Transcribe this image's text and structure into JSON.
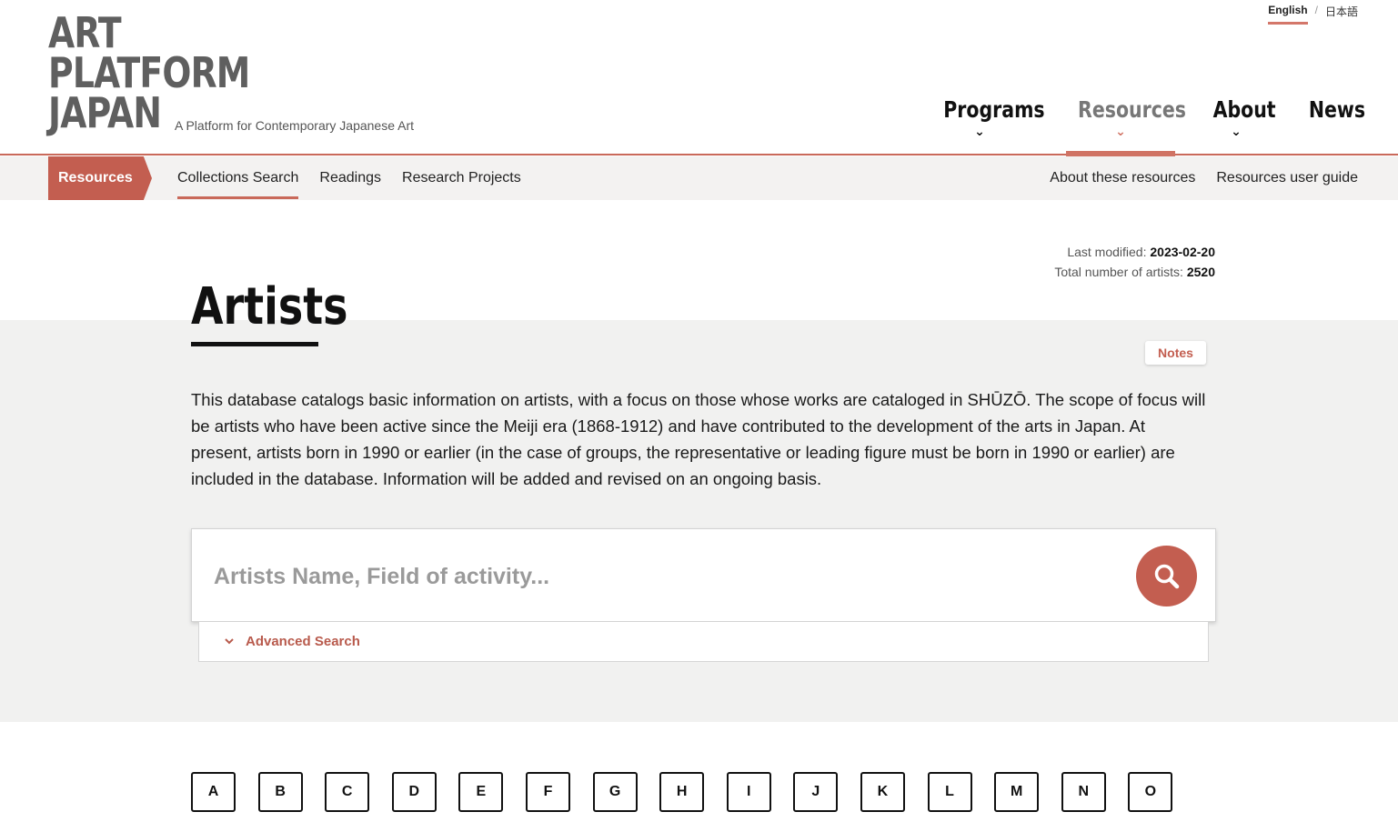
{
  "brand": {
    "logo_lines": [
      "ART",
      "PLATFORM",
      "JAPAN"
    ],
    "tagline": "A Platform for Contemporary Japanese Art"
  },
  "language": {
    "english": "English",
    "separator": "/",
    "japanese": "日本語"
  },
  "main_nav": {
    "programs": "Programs",
    "resources": "Resources",
    "about": "About",
    "news": "News",
    "active": "Resources"
  },
  "subnav": {
    "section_label": "Resources",
    "links": [
      "Collections Search",
      "Readings",
      "Research Projects"
    ],
    "right_links": [
      "About these resources",
      "Resources user guide"
    ]
  },
  "page": {
    "last_modified_label": "Last modified: ",
    "last_modified_value": "2023-02-20",
    "total_label": "Total number of artists: ",
    "total_value": "2520",
    "title": "Artists",
    "notes_label": "Notes",
    "description": "This database catalogs basic information on artists, with a focus on those whose works are cataloged in SHŪZŌ. The scope of focus will be artists who have been active since the Meiji era (1868-1912) and have contributed to the development of the arts in Japan. At present, artists born in 1990 or earlier (in the case of groups, the representative or leading figure must be born in 1990 or earlier) are included in the database. Information will be added and revised on an ongoing basis."
  },
  "search": {
    "placeholder": "Artists Name, Field of activity...",
    "value": "",
    "advanced_label": "Advanced Search"
  },
  "alphabet": [
    "A",
    "B",
    "C",
    "D",
    "E",
    "F",
    "G",
    "H",
    "I",
    "J",
    "K",
    "L",
    "M",
    "N",
    "O"
  ],
  "colors": {
    "accent": "#c35e50",
    "accent_light": "#d07364",
    "band": "#f1f1f0"
  }
}
